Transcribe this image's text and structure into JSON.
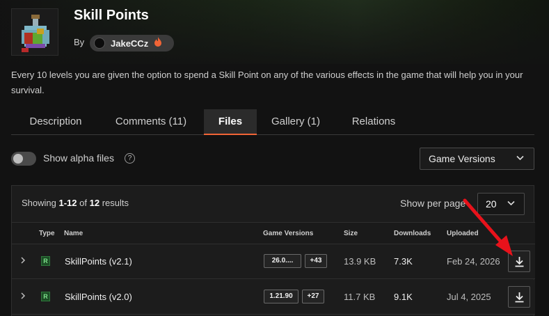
{
  "header": {
    "title": "Skill Points",
    "by_label": "By",
    "author": "JakeCCz",
    "description": "Every 10 levels you are given the option to spend a Skill Point on any of the various effects in the game that will help you in your survival."
  },
  "tabs": [
    {
      "label": "Description",
      "active": false
    },
    {
      "label": "Comments (11)",
      "active": false
    },
    {
      "label": "Files",
      "active": true
    },
    {
      "label": "Gallery (1)",
      "active": false
    },
    {
      "label": "Relations",
      "active": false
    }
  ],
  "filters": {
    "alpha_label": "Show alpha files",
    "alpha_enabled": false,
    "help_glyph": "?",
    "game_versions_label": "Game Versions"
  },
  "results": {
    "showing_prefix": "Showing",
    "range": "1-12",
    "of_label": "of",
    "total": "12",
    "suffix": "results",
    "per_page_label": "Show per page",
    "per_page_value": "20"
  },
  "columns": {
    "type": "Type",
    "name": "Name",
    "game_versions": "Game Versions",
    "size": "Size",
    "downloads": "Downloads",
    "uploaded": "Uploaded"
  },
  "files": [
    {
      "type": "R",
      "name": "SkillPoints (v2.1)",
      "version": "26.0....",
      "more": "+43",
      "size": "13.9 KB",
      "downloads": "7.3K",
      "uploaded": "Feb 24, 2026"
    },
    {
      "type": "R",
      "name": "SkillPoints (v2.0)",
      "version": "1.21.90",
      "more": "+27",
      "size": "11.7 KB",
      "downloads": "9.1K",
      "uploaded": "Jul 4, 2025"
    }
  ],
  "colors": {
    "accent": "#f16436",
    "release_badge": "#2f7a3c",
    "annotation_arrow": "#e8121b"
  },
  "icons": {
    "expand": "chevron-right-icon",
    "dropdown": "chevron-down-icon",
    "download": "download-icon",
    "help": "question-circle-icon",
    "author_badge": "flame-icon"
  }
}
